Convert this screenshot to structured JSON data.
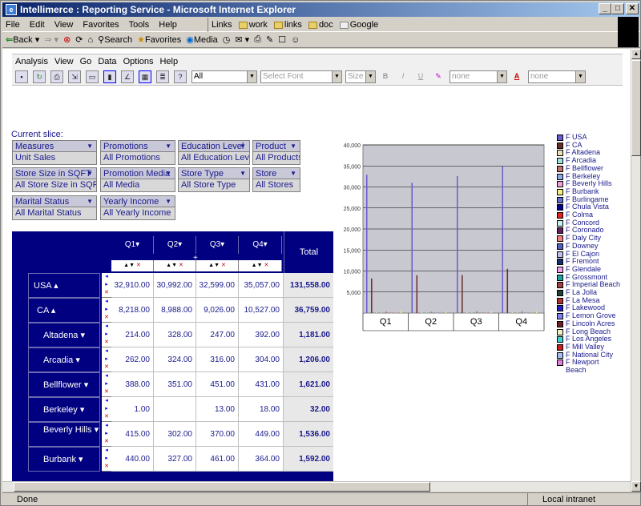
{
  "window": {
    "title": "Intellimerce : Reporting Service - Microsoft Internet Explorer"
  },
  "ie_menu": [
    "File",
    "Edit",
    "View",
    "Favorites",
    "Tools",
    "Help"
  ],
  "links": {
    "label": "Links",
    "items": [
      "work",
      "links",
      "doc",
      "Google"
    ]
  },
  "nav": {
    "back": "Back",
    "search": "Search",
    "favorites": "Favorites",
    "media": "Media"
  },
  "app_menu": [
    "Analysis",
    "View",
    "Go",
    "Data",
    "Options",
    "Help"
  ],
  "toolbar": {
    "member_select": "All",
    "font_select": "Select Font",
    "size_select": "Size",
    "bold": "B",
    "italic": "I",
    "underline": "U",
    "fill_color": "none",
    "text_color_label": "A",
    "font_color": "none"
  },
  "slice": {
    "label": "Current slice:",
    "selectors": [
      {
        "header": "Measures",
        "value": "Unit Sales"
      },
      {
        "header": "Promotions",
        "value": "All Promotions"
      },
      {
        "header": "Education Level",
        "value": "All Education Level"
      },
      {
        "header": "Product",
        "value": "All Products"
      },
      {
        "header": "Store Size in SQFT",
        "value": "All Store Size in SQFT"
      },
      {
        "header": "Promotion Media",
        "value": "All Media"
      },
      {
        "header": "Store Type",
        "value": "All Store Type"
      },
      {
        "header": "Store",
        "value": "All Stores"
      },
      {
        "header": "Marital Status",
        "value": "All Marital Status"
      },
      {
        "header": "Yearly Income",
        "value": "All Yearly Income"
      }
    ]
  },
  "grid": {
    "columns": [
      "Q1",
      "Q2",
      "Q3",
      "Q4"
    ],
    "total_label": "Total",
    "expand_symbol": "+",
    "rows": [
      {
        "label": "USA",
        "values": [
          "32,910.00",
          "30,992.00",
          "32,599.00",
          "35,057.00"
        ],
        "total": "131,558.00"
      },
      {
        "label": "CA",
        "values": [
          "8,218.00",
          "8,988.00",
          "9,026.00",
          "10,527.00"
        ],
        "total": "36,759.00"
      },
      {
        "label": "Altadena",
        "values": [
          "214.00",
          "328.00",
          "247.00",
          "392.00"
        ],
        "total": "1,181.00"
      },
      {
        "label": "Arcadia",
        "values": [
          "262.00",
          "324.00",
          "316.00",
          "304.00"
        ],
        "total": "1,206.00"
      },
      {
        "label": "Bellflower",
        "values": [
          "388.00",
          "351.00",
          "451.00",
          "431.00"
        ],
        "total": "1,621.00"
      },
      {
        "label": "Berkeley",
        "values": [
          "1.00",
          "",
          "13.00",
          "18.00"
        ],
        "total": "32.00"
      },
      {
        "label": "Beverly Hills",
        "values": [
          "415.00",
          "302.00",
          "370.00",
          "449.00"
        ],
        "total": "1,536.00"
      },
      {
        "label": "Burbank",
        "values": [
          "440.00",
          "327.00",
          "461.00",
          "364.00"
        ],
        "total": "1,592.00"
      }
    ]
  },
  "chart_data": {
    "type": "bar",
    "categories": [
      "Q1",
      "Q2",
      "Q3",
      "Q4"
    ],
    "ylim": [
      0,
      40000
    ],
    "yticks": [
      "5,000",
      "10,000",
      "15,000",
      "20,000",
      "25,000",
      "30,000",
      "35,000",
      "40,000"
    ],
    "series": [
      {
        "name": "F USA",
        "color": "#6a5acd",
        "values": [
          32910,
          30992,
          32599,
          35057
        ]
      },
      {
        "name": "F CA",
        "color": "#6b2a2a",
        "values": [
          8218,
          8988,
          9026,
          10527
        ]
      },
      {
        "name": "F Altadena",
        "color": "#e8e0b0",
        "values": [
          214,
          328,
          247,
          392
        ]
      },
      {
        "name": "F Arcadia",
        "color": "#a0e0e0",
        "values": [
          262,
          324,
          316,
          304
        ]
      },
      {
        "name": "F Bellflower",
        "color": "#c07070",
        "values": [
          388,
          351,
          451,
          431
        ]
      },
      {
        "name": "F Berkeley",
        "color": "#90a8e8",
        "values": [
          1,
          0,
          13,
          18
        ]
      },
      {
        "name": "F Beverly Hills",
        "color": "#f0a0d0",
        "values": [
          415,
          302,
          370,
          449
        ]
      },
      {
        "name": "F Burbank",
        "color": "#f0f080",
        "values": [
          440,
          327,
          461,
          364
        ]
      },
      {
        "name": "F Burlingame",
        "color": "#6070d0"
      },
      {
        "name": "F Chula Vista",
        "color": "#000090"
      },
      {
        "name": "F Colma",
        "color": "#e02020"
      },
      {
        "name": "F Concord",
        "color": "#c8f0f0"
      },
      {
        "name": "F Coronado",
        "color": "#602060"
      },
      {
        "name": "F Daly City",
        "color": "#f08080"
      },
      {
        "name": "F Downey",
        "color": "#5060c0"
      },
      {
        "name": "F El Cajon",
        "color": "#c0c0f0"
      },
      {
        "name": "F Fremont",
        "color": "#103070"
      },
      {
        "name": "F Glendale",
        "color": "#f0a0f0"
      },
      {
        "name": "F Grossmont",
        "color": "#20a0a0"
      },
      {
        "name": "F Imperial Beach",
        "color": "#a04040"
      },
      {
        "name": "F La Jolla",
        "color": "#204040"
      },
      {
        "name": "F La Mesa",
        "color": "#b03030"
      },
      {
        "name": "F Lakewood",
        "color": "#2020c0"
      },
      {
        "name": "F Lemon Grove",
        "color": "#8080f0"
      },
      {
        "name": "F Lincoln Acres",
        "color": "#702020"
      },
      {
        "name": "F Long Beach",
        "color": "#f0f0c0"
      },
      {
        "name": "F Los Angeles",
        "color": "#40d0d0"
      },
      {
        "name": "F Mill Valley",
        "color": "#c02020"
      },
      {
        "name": "F National City",
        "color": "#a0c0f0"
      },
      {
        "name": "F Newport Beach",
        "color": "#e080e0"
      }
    ]
  },
  "status": {
    "text": "Done",
    "zone": "Local intranet"
  }
}
